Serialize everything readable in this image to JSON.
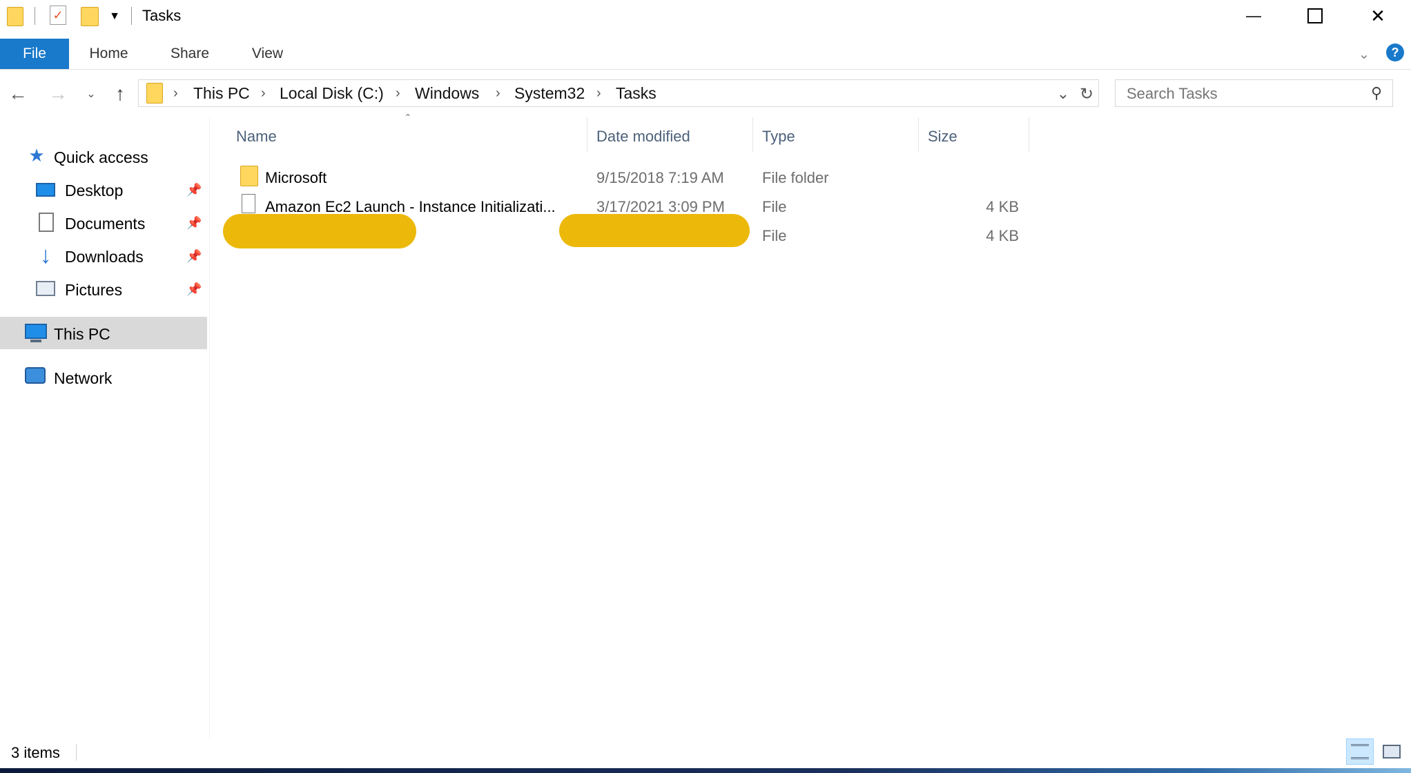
{
  "window": {
    "title": "Tasks",
    "controls": {
      "minimize": "—",
      "maximize": "☐",
      "close": "✕"
    }
  },
  "ribbon": {
    "tabs": [
      {
        "label": "File",
        "active": true
      },
      {
        "label": "Home"
      },
      {
        "label": "Share"
      },
      {
        "label": "View"
      }
    ],
    "help_icon": "?"
  },
  "address": {
    "breadcrumbs": [
      "This PC",
      "Local Disk (C:)",
      "Windows",
      "System32",
      "Tasks"
    ],
    "search_placeholder": "Search Tasks"
  },
  "nav": {
    "quick_access": "Quick access",
    "pinned": [
      {
        "label": "Desktop",
        "icon": "desktop-icon"
      },
      {
        "label": "Documents",
        "icon": "documents-icon"
      },
      {
        "label": "Downloads",
        "icon": "downloads-icon"
      },
      {
        "label": "Pictures",
        "icon": "pictures-icon"
      }
    ],
    "this_pc": "This PC",
    "network": "Network"
  },
  "columns": {
    "name": "Name",
    "date": "Date modified",
    "type": "Type",
    "size": "Size"
  },
  "files": [
    {
      "name": "Microsoft",
      "date": "9/15/2018 7:19 AM",
      "type": "File folder",
      "size": "",
      "icon": "folder-icon"
    },
    {
      "name": "Amazon Ec2 Launch - Instance Initializati...",
      "date": "3/17/2021 3:09 PM",
      "type": "File",
      "size": "4 KB",
      "icon": "file-icon"
    },
    {
      "name": "",
      "date": "",
      "type": "File",
      "size": "4 KB",
      "icon": "file-icon",
      "redacted": true
    }
  ],
  "status": {
    "item_count": "3 items"
  },
  "colors": {
    "accent": "#1979ca",
    "redaction": "#ecb90b",
    "folder": "#ffd75e"
  }
}
